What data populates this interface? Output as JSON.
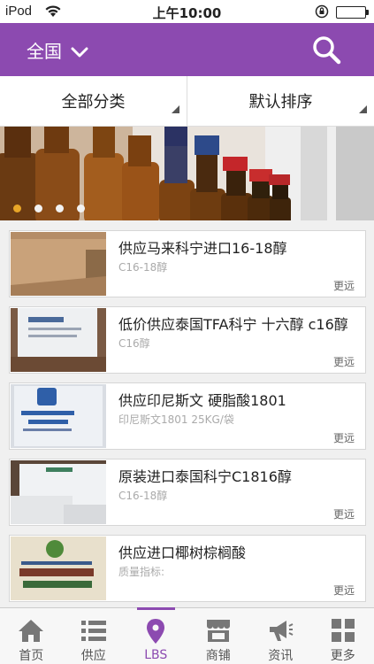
{
  "status_bar": {
    "carrier": "iPod",
    "time": "上午10:00"
  },
  "header": {
    "region": "全国"
  },
  "filters": {
    "category": "全部分类",
    "sort": "默认排序"
  },
  "banner": {
    "slide_count": 4,
    "active_index": 0
  },
  "items": [
    {
      "title": "供应马来科宁进口16-18醇",
      "subtitle": "C16-18醇",
      "more": "更远"
    },
    {
      "title": "低价供应泰国TFA科宁 十六醇 c16醇",
      "subtitle": "C16醇",
      "more": "更远"
    },
    {
      "title": "供应印尼斯文 硬脂酸1801",
      "subtitle": "印尼斯文1801 25KG/袋",
      "more": "更远"
    },
    {
      "title": "原装进口泰国科宁C1816醇",
      "subtitle": "C16-18醇",
      "more": "更远"
    },
    {
      "title": "供应进口椰树棕榈酸",
      "subtitle": "质量指标:",
      "more": "更远"
    }
  ],
  "tabs": [
    {
      "label": "首页",
      "icon": "home-icon"
    },
    {
      "label": "供应",
      "icon": "list-icon"
    },
    {
      "label": "LBS",
      "icon": "location-pin-icon"
    },
    {
      "label": "商铺",
      "icon": "store-icon"
    },
    {
      "label": "资讯",
      "icon": "megaphone-icon"
    },
    {
      "label": "更多",
      "icon": "grid-icon"
    }
  ],
  "colors": {
    "accent": "#8c4ab0",
    "dot_active": "#e8a628"
  }
}
